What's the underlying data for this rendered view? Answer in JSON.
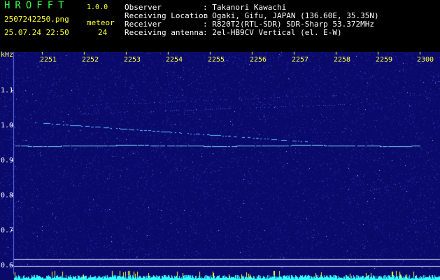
{
  "header": {
    "app_title": "HROFFT",
    "version": "1.0.0",
    "filename": "2507242250.png",
    "datetime": "25.07.24 22:50",
    "meteor_label": "meteor",
    "meteor_count": "24",
    "info": [
      {
        "label": "Observer",
        "value": ": Takanori Kawachi"
      },
      {
        "label": "Receiving Location",
        "value": ": Ogaki, Gifu, JAPAN (136.60E, 35.35N)"
      },
      {
        "label": "Receiver",
        "value": ": R820T2(RTL-SDR) SDR-Sharp 53.372MHz"
      },
      {
        "label": "Receiving antenna",
        "value": ": 2el-HB9CV Vertical (el. E-W)"
      }
    ]
  },
  "axis": {
    "unit": "kHz",
    "x_ticks": [
      "2251",
      "2252",
      "2253",
      "2254",
      "2255",
      "2256",
      "2257",
      "2258",
      "2259",
      "2300"
    ],
    "y_ticks": [
      "1.1",
      "1.0",
      "0.9",
      "0.8",
      "0.7",
      "0.6"
    ]
  },
  "colors": {
    "background": "#0a0a6a",
    "trace": "#7fd8ff",
    "text_green": "#33ff44",
    "text_yellow": "#ffff33",
    "baseline": "#33ffff"
  }
}
